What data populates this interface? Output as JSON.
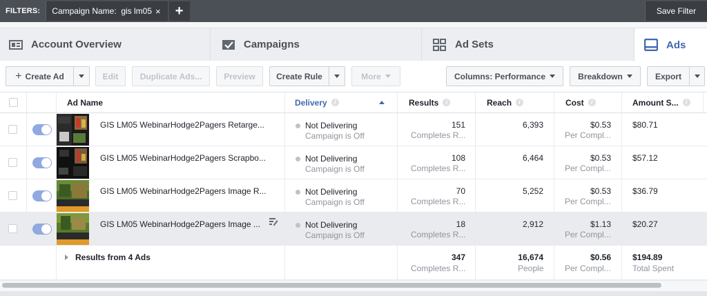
{
  "filters": {
    "label": "FILTERS:",
    "chip_text": "Campaign Name:  gis lm05",
    "chip_close": "×",
    "add": "+",
    "save_filter": "Save Filter"
  },
  "tabs": [
    {
      "label": "Account Overview",
      "icon": "dashboard-icon"
    },
    {
      "label": "Campaigns",
      "icon": "folder-check-icon"
    },
    {
      "label": "Ad Sets",
      "icon": "grid-icon"
    },
    {
      "label": "Ads",
      "icon": "ad-icon",
      "active": true
    }
  ],
  "toolbar": {
    "create_ad": "Create Ad",
    "edit": "Edit",
    "duplicate": "Duplicate Ads...",
    "preview": "Preview",
    "create_rule": "Create Rule",
    "more": "More",
    "columns": "Columns: Performance",
    "breakdown": "Breakdown",
    "export": "Export"
  },
  "columns": {
    "ad_name": "Ad Name",
    "delivery": "Delivery",
    "results": "Results",
    "reach": "Reach",
    "cost": "Cost",
    "amount": "Amount S..."
  },
  "rows": [
    {
      "name": "GIS LM05 WebinarHodge2Pagers Retarge...",
      "delivery": "Not Delivering",
      "delivery_sub": "Campaign is Off",
      "results": "151",
      "results_sub": "Completes R...",
      "reach": "6,393",
      "cost": "$0.53",
      "cost_sub": "Per Compl...",
      "amount": "$80.71"
    },
    {
      "name": "GIS LM05 WebinarHodge2Pagers Scrapbo...",
      "delivery": "Not Delivering",
      "delivery_sub": "Campaign is Off",
      "results": "108",
      "results_sub": "Completes R...",
      "reach": "6,464",
      "cost": "$0.53",
      "cost_sub": "Per Compl...",
      "amount": "$57.12"
    },
    {
      "name": "GIS LM05 WebinarHodge2Pagers Image R...",
      "delivery": "Not Delivering",
      "delivery_sub": "Campaign is Off",
      "results": "70",
      "results_sub": "Completes R...",
      "reach": "5,252",
      "cost": "$0.53",
      "cost_sub": "Per Compl...",
      "amount": "$36.79"
    },
    {
      "name": "GIS LM05 WebinarHodge2Pagers Image ...",
      "delivery": "Not Delivering",
      "delivery_sub": "Campaign is Off",
      "results": "18",
      "results_sub": "Completes R...",
      "reach": "2,912",
      "cost": "$1.13",
      "cost_sub": "Per Compl...",
      "amount": "$20.27"
    }
  ],
  "summary": {
    "label": "Results from 4 Ads",
    "results": "347",
    "results_sub": "Completes R...",
    "reach": "16,674",
    "reach_sub": "People",
    "cost": "$0.56",
    "cost_sub": "Per Compl...",
    "amount": "$194.89",
    "amount_sub": "Total Spent"
  },
  "colors": {
    "accent": "#4267b2",
    "toggle_on": "#90a9e0",
    "filter_bar": "#4b4f56"
  }
}
